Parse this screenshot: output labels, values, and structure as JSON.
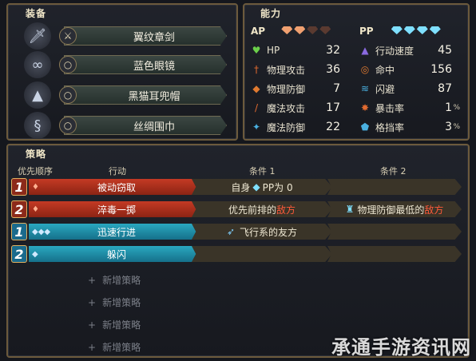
{
  "equipment": {
    "title": "装备",
    "items": [
      {
        "name": "翼纹章剑",
        "slot_icon": "sword-icon",
        "icon": "sword-icon"
      },
      {
        "name": "蓝色眼镜",
        "slot_icon": "ring-icon",
        "icon": "glasses-icon"
      },
      {
        "name": "黑猫耳兜帽",
        "slot_icon": "ring-icon",
        "icon": "hood-icon"
      },
      {
        "name": "丝绸围巾",
        "slot_icon": "ring-icon",
        "icon": "scarf-icon"
      }
    ]
  },
  "abilities": {
    "title": "能力",
    "ap_label": "AP",
    "pp_label": "PP",
    "stats_left": [
      {
        "name": "HP",
        "value": "32",
        "icon": "heart-icon",
        "color": "#6bcf4a"
      },
      {
        "name": "物理攻击",
        "value": "36",
        "icon": "sword-icon",
        "color": "#e06a30"
      },
      {
        "name": "物理防御",
        "value": "7",
        "icon": "shield-icon",
        "color": "#e07a30"
      },
      {
        "name": "魔法攻击",
        "value": "17",
        "icon": "wand-icon",
        "color": "#e06a30"
      },
      {
        "name": "魔法防御",
        "value": "22",
        "icon": "magic-shield-icon",
        "color": "#4ab0e0"
      }
    ],
    "stats_right": [
      {
        "name": "行动速度",
        "value": "45",
        "icon": "boot-icon",
        "color": "#8a6ae0",
        "unit": ""
      },
      {
        "name": "命中",
        "value": "156",
        "icon": "target-icon",
        "color": "#e07a30",
        "unit": ""
      },
      {
        "name": "闪避",
        "value": "87",
        "icon": "dodge-icon",
        "color": "#4ab0e0",
        "unit": ""
      },
      {
        "name": "暴击率",
        "value": "1",
        "icon": "crit-icon",
        "color": "#e06a30",
        "unit": "%"
      },
      {
        "name": "格挡率",
        "value": "3",
        "icon": "block-icon",
        "color": "#4ab0e0",
        "unit": "%"
      }
    ]
  },
  "strategy": {
    "title": "策略",
    "headers": {
      "priority": "优先顺序",
      "action": "行动",
      "cond1": "条件 1",
      "cond2": "条件 2"
    },
    "rows": [
      {
        "num": "1",
        "type": "ap",
        "gems": "♦",
        "action": "被动窃取",
        "cond1_pre": "自身 ",
        "cond1_mid": "PP为 0",
        "cond1_red": "",
        "cond2_pre": "",
        "cond2_red": ""
      },
      {
        "num": "2",
        "type": "ap",
        "gems": "♦",
        "action": "淬毒一掷",
        "cond1_pre": "优先前排的",
        "cond1_mid": "",
        "cond1_red": "敌方",
        "cond2_pre": "物理防御最低的",
        "cond2_red": "敌方"
      },
      {
        "num": "1",
        "type": "pp",
        "gems": "◆◆◆",
        "action": "迅速行进",
        "cond1_pre": "飞行系的友方",
        "cond1_mid": "",
        "cond1_red": "",
        "cond2_pre": "",
        "cond2_red": ""
      },
      {
        "num": "2",
        "type": "pp",
        "gems": "◆",
        "action": "躲闪",
        "cond1_pre": "",
        "cond1_mid": "",
        "cond1_red": "",
        "cond2_pre": "",
        "cond2_red": ""
      }
    ],
    "add_label": "新增策略",
    "add_count": 4
  },
  "watermark": "承通手游资讯网",
  "colors": {
    "ap_row": "#b9321f",
    "pp_row": "#1f8fa8",
    "gold_border": "#6c5a3c"
  }
}
